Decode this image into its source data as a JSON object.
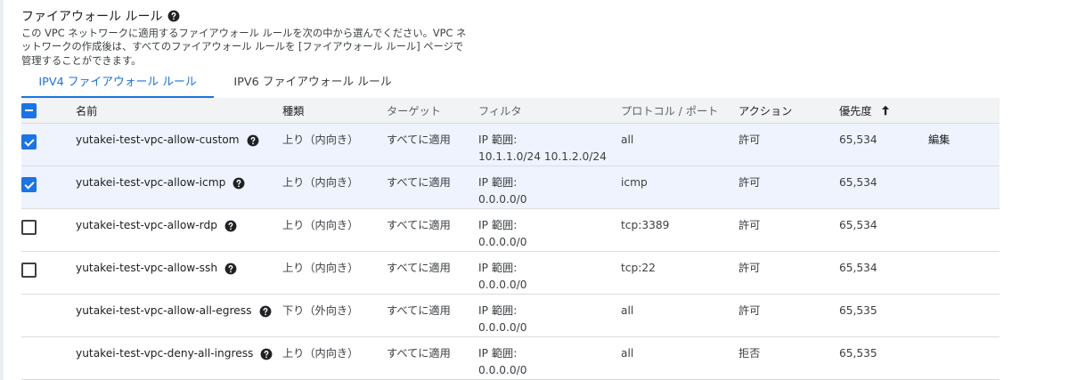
{
  "section": {
    "title": "ファイアウォール ルール",
    "description": "この VPC ネットワークに適用するファイアウォール ルールを次の中から選んでください。VPC ネットワークの作成後は、すべてのファイアウォール ルールを [ファイアウォール ルール] ページで管理することができます。"
  },
  "tabs": [
    {
      "label": "IPV4 ファイアウォール ルール",
      "active": true
    },
    {
      "label": "IPV6 ファイアウォール ルール",
      "active": false
    }
  ],
  "table": {
    "header_checkbox_state": "indeterminate",
    "columns": {
      "name": "名前",
      "type": "種類",
      "target": "ターゲット",
      "filter": "フィルタ",
      "protocol": "プロトコル / ポート",
      "action": "アクション",
      "priority": "優先度"
    },
    "sort": {
      "column": "priority",
      "direction": "ascending"
    },
    "rows": [
      {
        "checkbox": "checked",
        "name": "yutakei-test-vpc-allow-custom",
        "type": "上り（内向き）",
        "target": "すべてに適用",
        "filter_label": "IP 範囲:",
        "filter_value": "10.1.1.0/24 10.1.2.0/24",
        "protocol": "all",
        "action": "許可",
        "priority": "65,534",
        "edit": "編集"
      },
      {
        "checkbox": "checked",
        "name": "yutakei-test-vpc-allow-icmp",
        "type": "上り（内向き）",
        "target": "すべてに適用",
        "filter_label": "IP 範囲:",
        "filter_value": "0.0.0.0/0",
        "protocol": "icmp",
        "action": "許可",
        "priority": "65,534",
        "edit": ""
      },
      {
        "checkbox": "unchecked",
        "name": "yutakei-test-vpc-allow-rdp",
        "type": "上り（内向き）",
        "target": "すべてに適用",
        "filter_label": "IP 範囲:",
        "filter_value": "0.0.0.0/0",
        "protocol": "tcp:3389",
        "action": "許可",
        "priority": "65,534",
        "edit": ""
      },
      {
        "checkbox": "unchecked",
        "name": "yutakei-test-vpc-allow-ssh",
        "type": "上り（内向き）",
        "target": "すべてに適用",
        "filter_label": "IP 範囲:",
        "filter_value": "0.0.0.0/0",
        "protocol": "tcp:22",
        "action": "許可",
        "priority": "65,534",
        "edit": ""
      },
      {
        "checkbox": "none",
        "name": "yutakei-test-vpc-allow-all-egress",
        "type": "下り（外向き）",
        "target": "すべてに適用",
        "filter_label": "IP 範囲:",
        "filter_value": "0.0.0.0/0",
        "protocol": "all",
        "action": "許可",
        "priority": "65,535",
        "edit": ""
      },
      {
        "checkbox": "none",
        "name": "yutakei-test-vpc-deny-all-ingress",
        "type": "上り（内向き）",
        "target": "すべてに適用",
        "filter_label": "IP 範囲:",
        "filter_value": "0.0.0.0/0",
        "protocol": "all",
        "action": "拒否",
        "priority": "65,535",
        "edit": ""
      }
    ]
  },
  "colors": {
    "accent": "#1a73e8",
    "selected_row": "#eef3fd",
    "header_bg": "#f1f3f4"
  }
}
